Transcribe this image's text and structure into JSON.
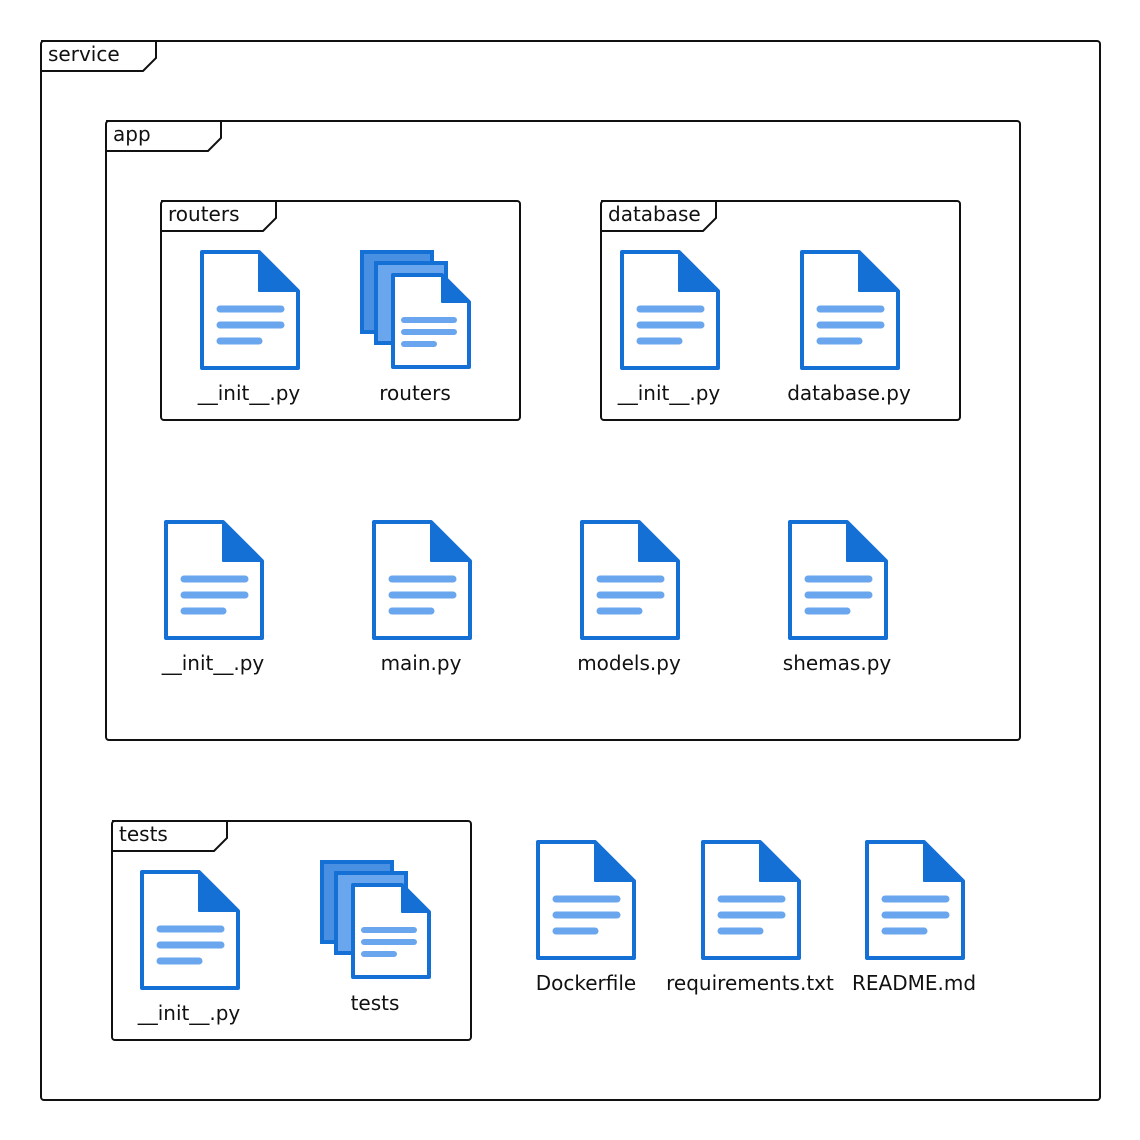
{
  "colors": {
    "border": "#111111",
    "icon_dark": "#1570d6",
    "icon_light": "#6aa6ee",
    "icon_mid": "#4a90e2",
    "paper": "#ffffff"
  },
  "packages": {
    "service": "service",
    "app": "app",
    "routers": "routers",
    "database": "database",
    "tests": "tests"
  },
  "files": {
    "routers_init": "__init__.py",
    "routers_dir": "routers",
    "database_init": "__init__.py",
    "database_py": "database.py",
    "app_init": "__init__.py",
    "main": "main.py",
    "models": "models.py",
    "schemas": "shemas.py",
    "tests_init": "__init__.py",
    "tests_dir": "tests",
    "dockerfile": "Dockerfile",
    "requirements": "requirements.txt",
    "readme": "README.md"
  },
  "icons": {
    "file": "document-icon",
    "folder": "stacked-documents-icon"
  }
}
